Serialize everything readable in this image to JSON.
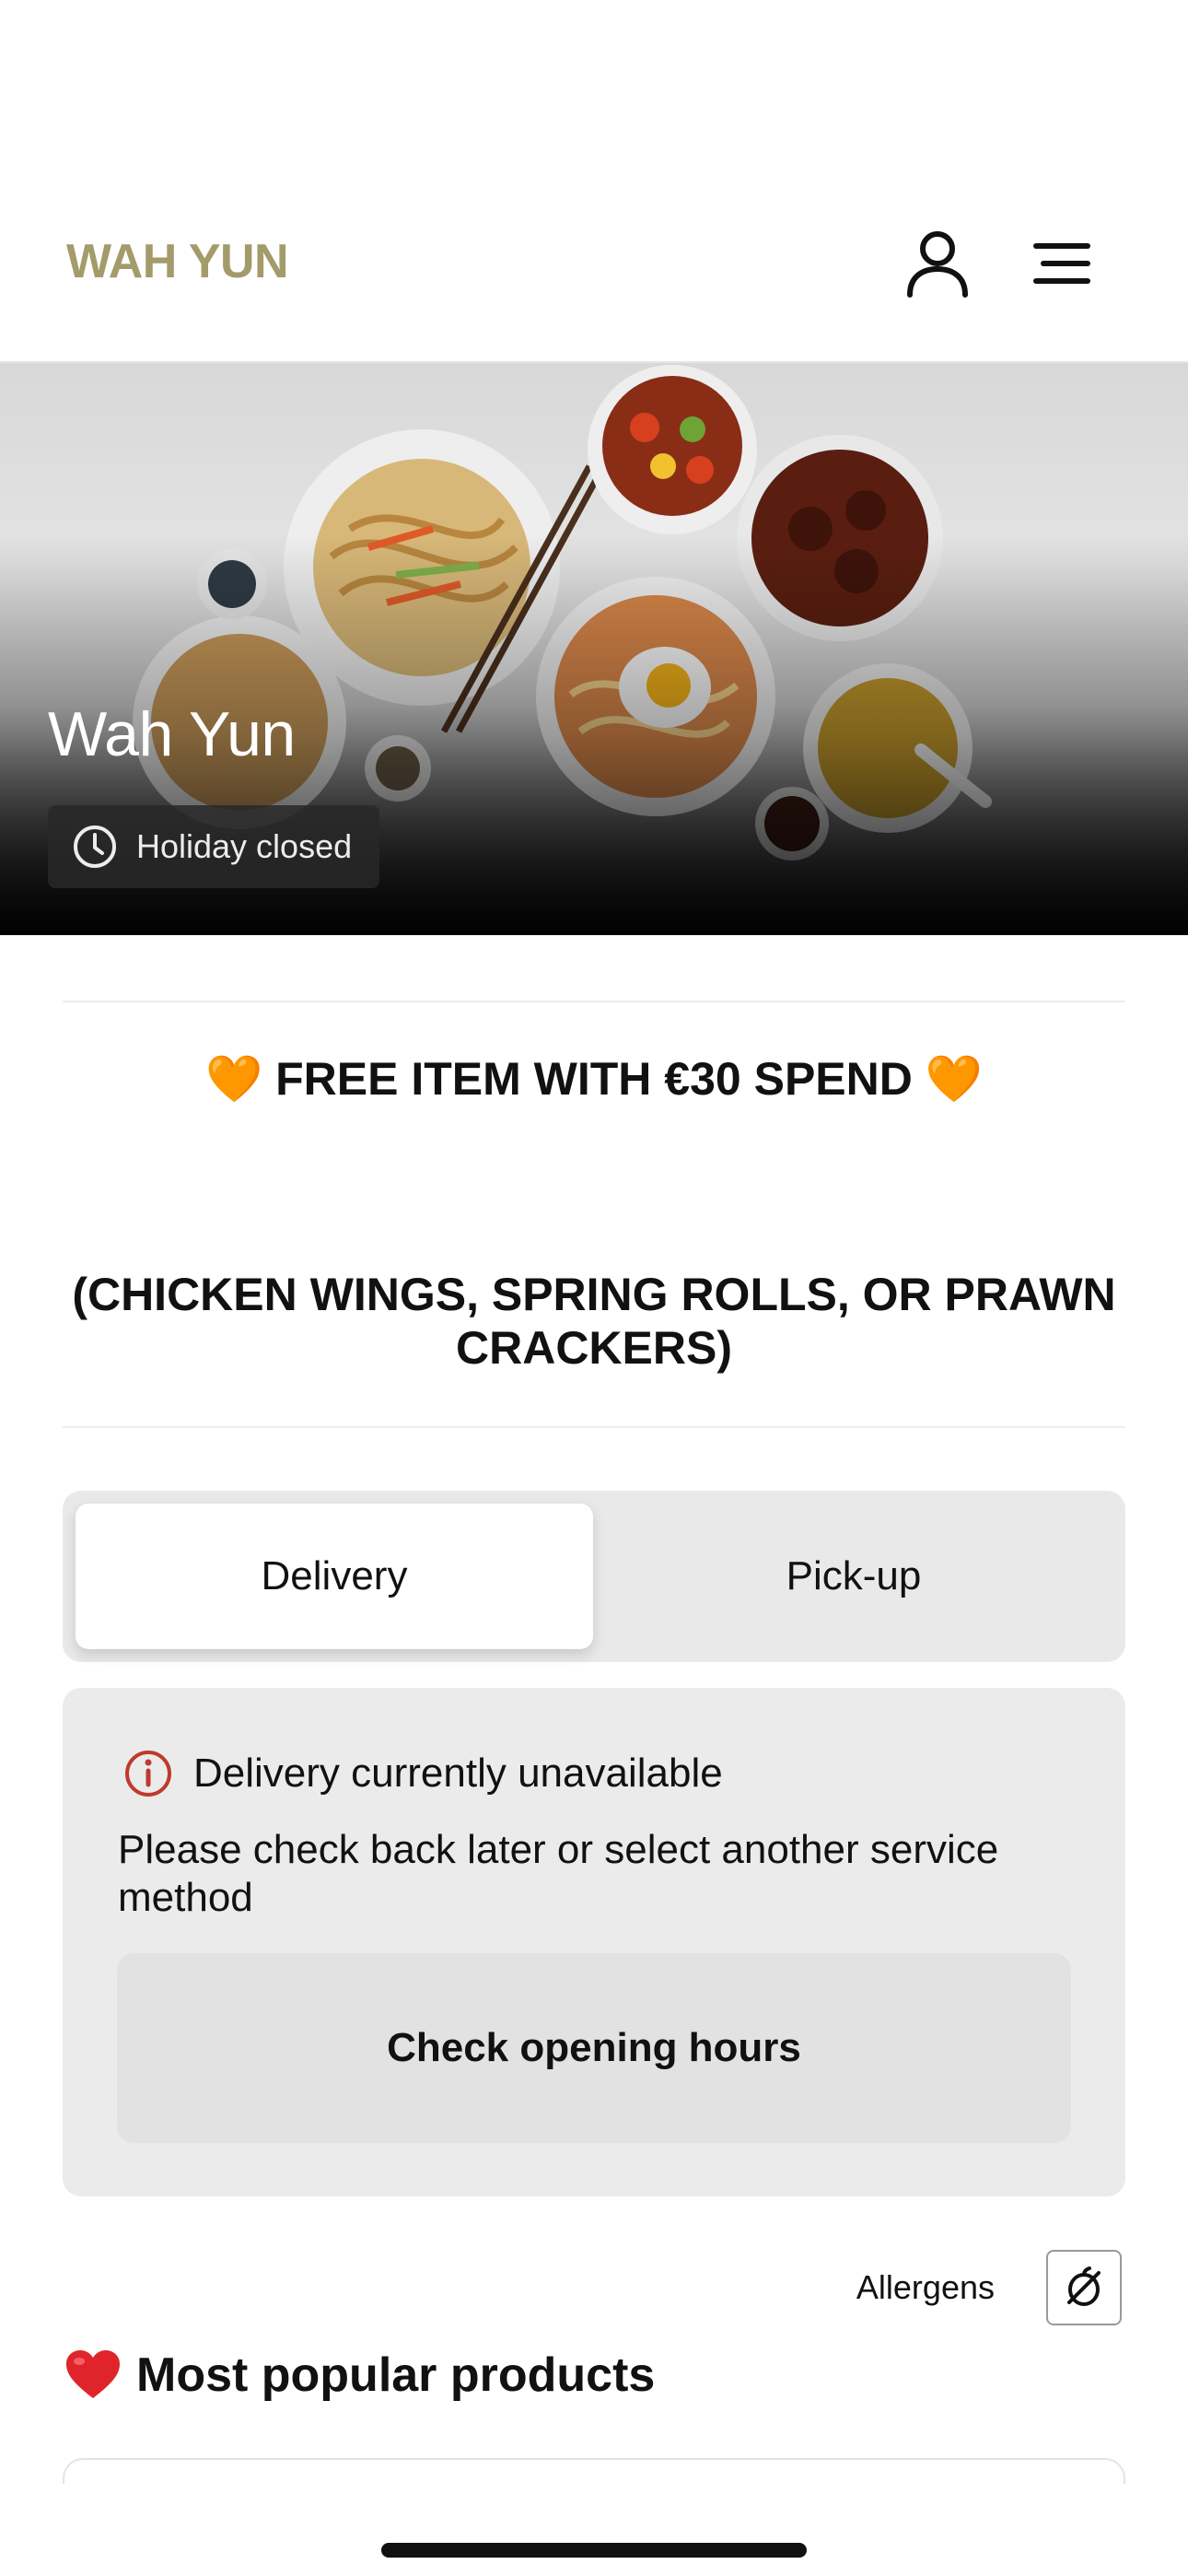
{
  "header": {
    "brand": "WAH YUN",
    "account_icon": "user-icon",
    "menu_icon": "menu-icon"
  },
  "hero": {
    "title": "Wah Yun",
    "status_icon": "clock-icon",
    "status_text": "Holiday closed"
  },
  "promo": {
    "line1": "🧡 FREE ITEM WITH €30 SPEND 🧡",
    "line2": "(CHICKEN WINGS, SPRING ROLLS, OR PRAWN CRACKERS)"
  },
  "service_toggle": {
    "options": [
      {
        "label": "Delivery",
        "selected": true
      },
      {
        "label": "Pick-up",
        "selected": false
      }
    ]
  },
  "notice": {
    "icon": "alert-circle-icon",
    "title": "Delivery currently unavailable",
    "message": "Please check back later or select another service method",
    "button_label": "Check opening hours"
  },
  "allergens": {
    "label": "Allergens",
    "icon": "allergen-filter-icon"
  },
  "popular": {
    "emoji": "❤️",
    "title": "Most popular products"
  },
  "colors": {
    "brand": "#a39b6a",
    "alert": "#c0392b",
    "promo_heart": "#ff9a1f",
    "popular_heart": "#e0242b"
  }
}
